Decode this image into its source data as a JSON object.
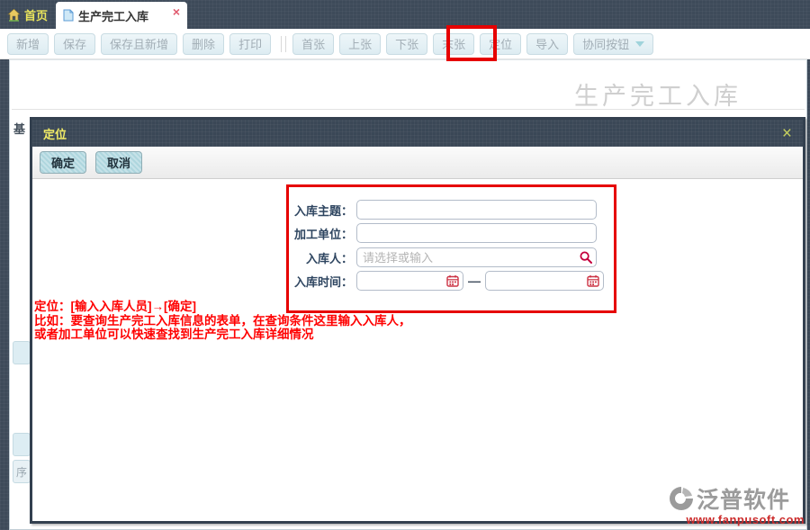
{
  "colors": {
    "topbar_dark": "#3d4a59",
    "modal_header_dark": "#3a4756",
    "tab_text_yellow": "#e9e45c",
    "highlight_red": "#e60000",
    "annotation_red": "#ff0000",
    "toolbar_button_bg": "#e3f0f4",
    "modal_button_teal": "#aed6de",
    "watermark_gray": "#9b9b9b",
    "watermark_url_red": "#cc2b2b"
  },
  "topbar": {
    "home_tab": "首页",
    "active_tab": "生产完工入库",
    "close_icon": "×"
  },
  "toolbar": {
    "new": "新增",
    "save": "保存",
    "save_and_new": "保存且新增",
    "delete": "删除",
    "print": "打印",
    "first": "首张",
    "prev": "上张",
    "next": "下张",
    "last": "末张",
    "locate": "定位",
    "import": "导入",
    "collab": "协同按钮"
  },
  "page": {
    "title": "生产完工入库",
    "partial_tab_text": "基",
    "partial_column_text": "序"
  },
  "modal": {
    "title": "定位",
    "close_icon": "×",
    "ok": "确定",
    "cancel": "取消",
    "form": {
      "fields": [
        {
          "label": "入库主题：",
          "value": ""
        },
        {
          "label": "加工单位：",
          "value": ""
        },
        {
          "label": "入库人：",
          "value": "",
          "placeholder": "请选择或输入"
        },
        {
          "label": "入库时间：",
          "value_from": "",
          "value_to": "",
          "range_separator": "—"
        }
      ]
    }
  },
  "annotation": {
    "line1": "定位：[输入入库人员]→[确定]",
    "line2": "比如：要查询生产完工入库信息的表单，在查询条件这里输入入库人，",
    "line3": "或者加工单位可以快速查找到生产完工入库详细情况"
  },
  "watermark": {
    "brand": "泛普软件",
    "url": "www.fanpusoft.com"
  }
}
